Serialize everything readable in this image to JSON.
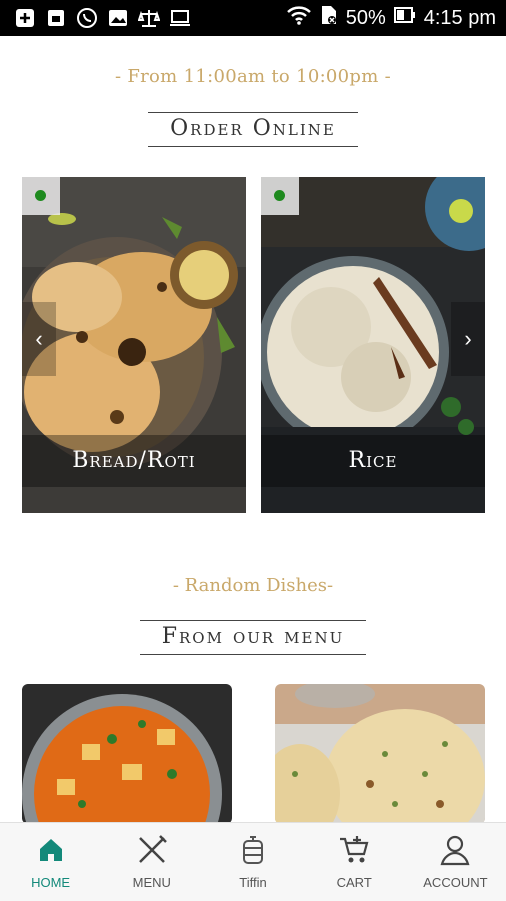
{
  "status_bar": {
    "battery": "50%",
    "time": "4:15 pm"
  },
  "hours_text": "- From 11:00am to 10:00pm -",
  "order_title": "Order Online",
  "categories": [
    {
      "label": "Bread/Roti"
    },
    {
      "label": "Rice"
    }
  ],
  "random_subtitle": "- Random Dishes-",
  "menu_title": "From our menu",
  "nav": [
    {
      "label": "HOME",
      "icon": "home-icon",
      "active": true
    },
    {
      "label": "MENU",
      "icon": "fork-knife-icon"
    },
    {
      "label": "Tiffin",
      "icon": "tiffin-icon"
    },
    {
      "label": "CART",
      "icon": "cart-icon"
    },
    {
      "label": "ACCOUNT",
      "icon": "account-icon"
    }
  ],
  "colors": {
    "accent": "#13897a",
    "gold": "#c9a86a",
    "veg": "#1e8a1e"
  }
}
